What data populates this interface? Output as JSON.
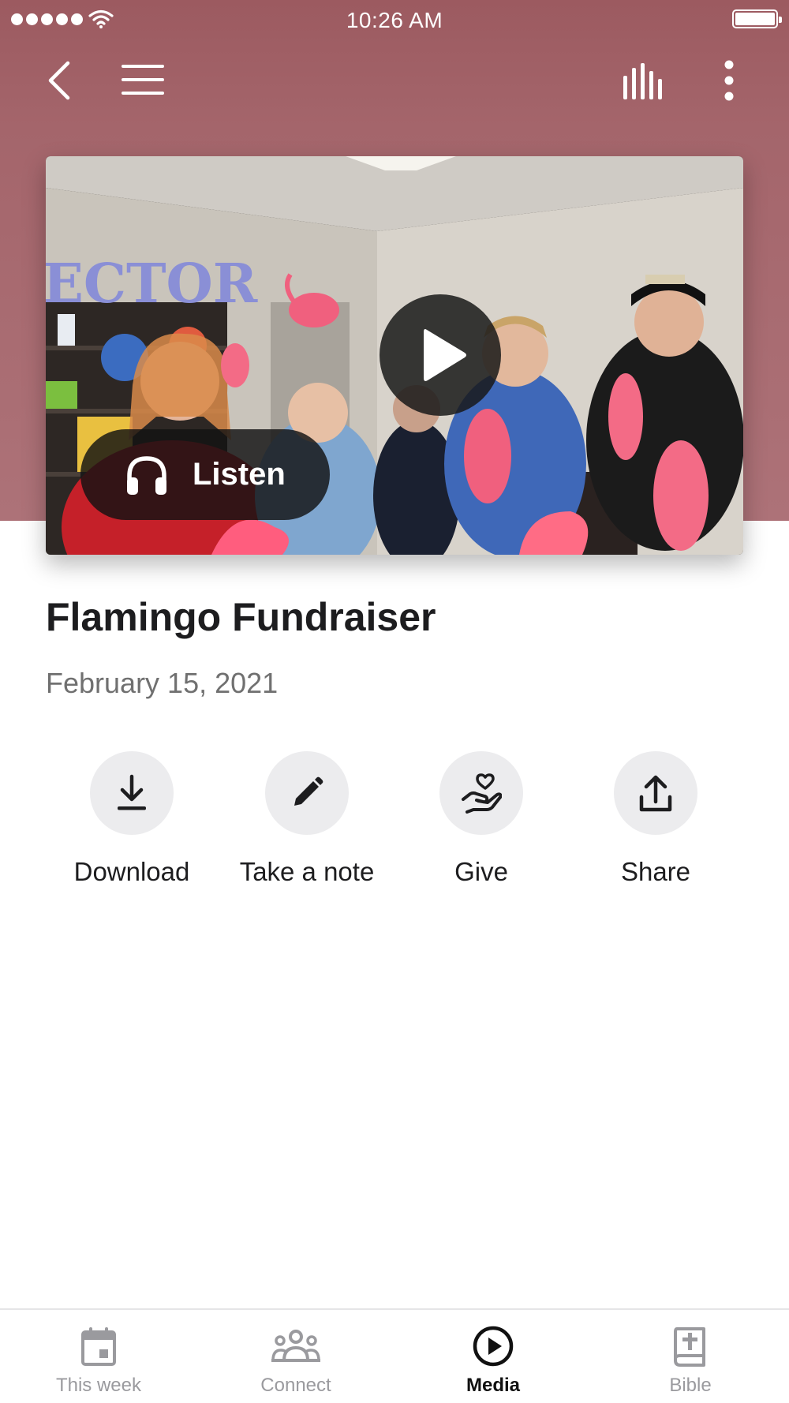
{
  "status_bar": {
    "time": "10:26 AM"
  },
  "nav": {
    "back_icon": "chevron-left-icon",
    "menu_icon": "hamburger-menu-icon",
    "audio_icon": "audio-bars-icon",
    "more_icon": "more-vertical-icon"
  },
  "video": {
    "play_icon": "play-icon",
    "listen": {
      "icon": "headphones-icon",
      "label": "Listen"
    },
    "sign_text": "ECTOR"
  },
  "content": {
    "title": "Flamingo Fundraiser",
    "date": "February 15, 2021"
  },
  "actions": [
    {
      "icon": "download-icon",
      "label": "Download"
    },
    {
      "icon": "pencil-icon",
      "label": "Take a note"
    },
    {
      "icon": "give-heart-hand-icon",
      "label": "Give"
    },
    {
      "icon": "share-icon",
      "label": "Share"
    }
  ],
  "tabs": [
    {
      "icon": "calendar-icon",
      "label": "This week",
      "active": false
    },
    {
      "icon": "people-icon",
      "label": "Connect",
      "active": false
    },
    {
      "icon": "play-circle-icon",
      "label": "Media",
      "active": true
    },
    {
      "icon": "bible-icon",
      "label": "Bible",
      "active": false
    }
  ],
  "colors": {
    "header": "#a4656b",
    "accent_flamingo": "#f0607e",
    "tab_active": "#111111",
    "tab_inactive": "#9a9a9e"
  }
}
